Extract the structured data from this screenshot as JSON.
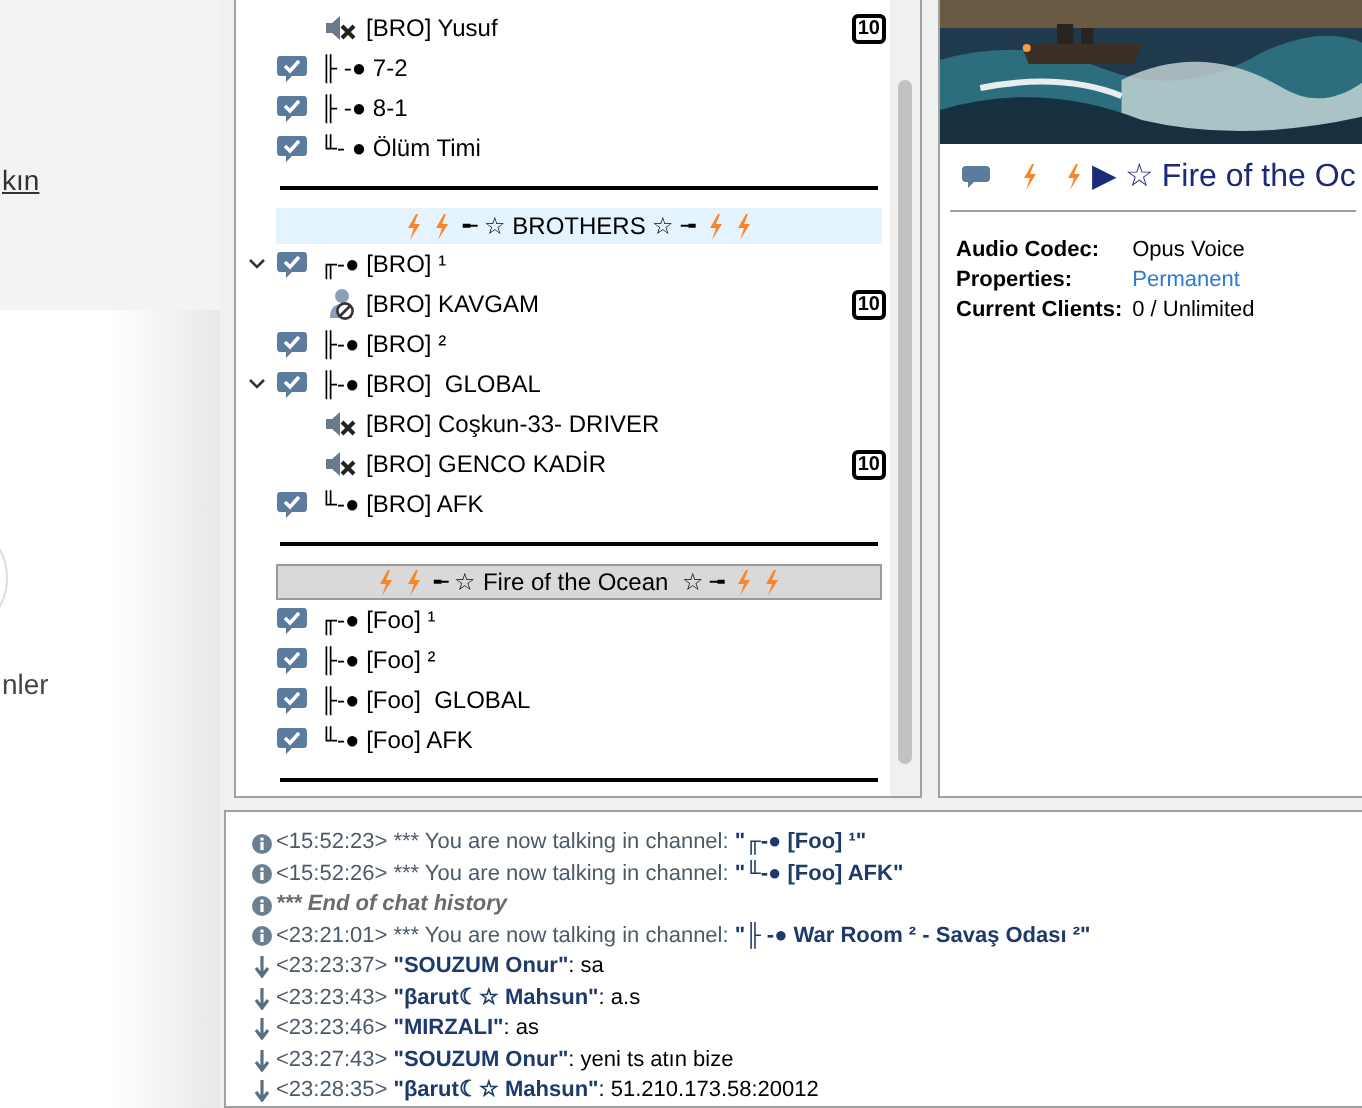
{
  "background_page": {
    "link": "kın",
    "text": "nler"
  },
  "tree": [
    {
      "kind": "muted_client",
      "name": "[BRO] Yusuf",
      "badge": "10"
    },
    {
      "kind": "channel",
      "name": "╟ -● 7-2"
    },
    {
      "kind": "channel",
      "name": "╟ -● 8-1"
    },
    {
      "kind": "channel",
      "name": "╙- ● Ölüm Timi"
    },
    {
      "kind": "separator"
    },
    {
      "kind": "spacer",
      "selected": true,
      "name": "╾ ☆ BROTHERS ☆ ╼"
    },
    {
      "kind": "channel",
      "expanded": true,
      "name": "╓-● [BRO] ¹"
    },
    {
      "kind": "away_client",
      "name": "[BRO] KAVGAM",
      "badge": "10"
    },
    {
      "kind": "channel",
      "name": "╟-● [BRO] ²"
    },
    {
      "kind": "channel",
      "expanded": true,
      "name": "╟-● [BRO]  GLOBAL"
    },
    {
      "kind": "muted_client",
      "name": "[BRO] Coşkun-33- DRIVER"
    },
    {
      "kind": "muted_client",
      "name": "[BRO] GENCO KADİR",
      "badge": "10"
    },
    {
      "kind": "channel",
      "name": "╙-● [BRO] AFK"
    },
    {
      "kind": "separator"
    },
    {
      "kind": "spacer",
      "selected": false,
      "name": "╾ ☆ Fire of the Ocean  ☆ ╼"
    },
    {
      "kind": "channel",
      "name": "╓-● [Foo] ¹"
    },
    {
      "kind": "channel",
      "name": "╟-● [Foo] ²"
    },
    {
      "kind": "channel",
      "name": "╟-● [Foo]  GLOBAL"
    },
    {
      "kind": "channel",
      "name": "╙-● [Foo] AFK"
    },
    {
      "kind": "separator"
    }
  ],
  "info": {
    "title": "▶ ☆ Fire of the Oc",
    "properties": [
      {
        "label": "Audio Codec:",
        "value": "Opus Voice",
        "link": false
      },
      {
        "label": "Properties:",
        "value": "Permanent",
        "link": true
      },
      {
        "label": "Current Clients:",
        "value": "0 / Unlimited",
        "link": false
      }
    ]
  },
  "chat": [
    {
      "kind": "info",
      "time": "<15:52:23>",
      "text": "*** You are now talking in channel: ",
      "channel": "\"╓-● [Foo] ¹\""
    },
    {
      "kind": "info",
      "time": "<15:52:26>",
      "text": "*** You are now talking in channel: ",
      "channel": "\"╙-● [Foo] AFK\""
    },
    {
      "kind": "history_end",
      "text": "*** End of chat history"
    },
    {
      "kind": "info",
      "time": "<23:21:01>",
      "text": "*** You are now talking in channel: ",
      "channel": "\"╟ -● War Room ² - Savaş Odası ²\""
    },
    {
      "kind": "message",
      "time": "<23:23:37>",
      "sender": "\"SOUZUM Onur\"",
      "text": ": sa"
    },
    {
      "kind": "message",
      "time": "<23:23:43>",
      "sender": "\"βarut☾☆ Mahsun\"",
      "text": ": a.s"
    },
    {
      "kind": "message",
      "time": "<23:23:46>",
      "sender": "\"MIRZALI\"",
      "text": ": as"
    },
    {
      "kind": "message",
      "time": "<23:27:43>",
      "sender": "\"SOUZUM Onur\"",
      "text": ": yeni ts atın bize"
    },
    {
      "kind": "message",
      "time": "<23:28:35>",
      "sender": "\"βarut☾☆ Mahsun\"",
      "text": ": 51.210.173.58:20012"
    }
  ]
}
